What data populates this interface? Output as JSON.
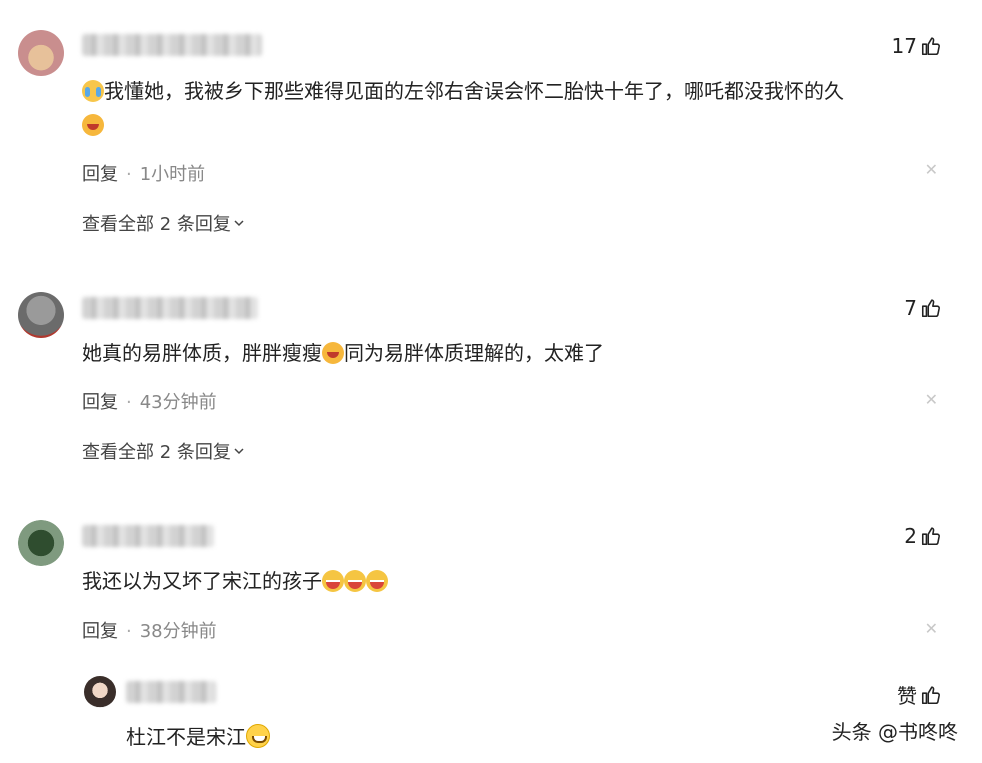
{
  "comments": [
    {
      "likes": "17",
      "text": "我懂她，我被乡下那些难得见面的左邻右舍误会怀二胎快十年了，哪吒都没我怀的久",
      "reply_label": "回复",
      "time": "1小时前",
      "view_replies": "查看全部 2 条回复"
    },
    {
      "likes": "7",
      "text_part1": "她真的易胖体质，胖胖瘦瘦",
      "text_part2": "同为易胖体质理解的，太难了",
      "reply_label": "回复",
      "time": "43分钟前",
      "view_replies": "查看全部 2 条回复"
    },
    {
      "likes": "2",
      "text": "我还以为又坏了宋江的孩子",
      "reply_label": "回复",
      "time": "38分钟前",
      "sub_reply": {
        "like_label": "赞",
        "text": "杜江不是宋江"
      }
    }
  ],
  "watermark": "头条 @书咚咚",
  "icons": {
    "thumb": "thumbs-up-icon",
    "close": "close-icon",
    "chevron": "chevron-down-icon"
  }
}
